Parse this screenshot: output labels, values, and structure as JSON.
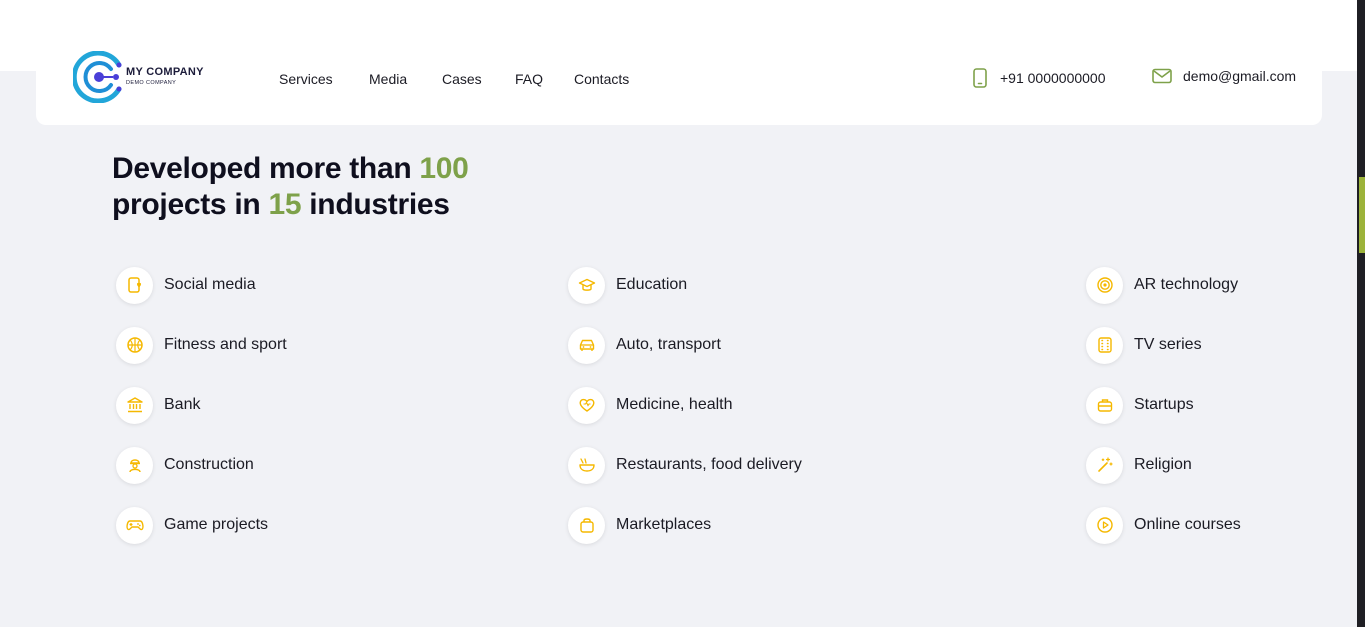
{
  "logo": {
    "name": "MY COMPANY",
    "subtitle": "DEMO COMPANY"
  },
  "nav": [
    "Services",
    "Media",
    "Cases",
    "FAQ",
    "Contacts"
  ],
  "contacts": {
    "phone": "+91 0000000000",
    "email": "demo@gmail.com"
  },
  "headline": {
    "part1": "Developed more than ",
    "num1": "100",
    "part2": "projects in ",
    "num2": "15",
    "part3": " industries"
  },
  "industries": {
    "col1": [
      {
        "label": "Social media",
        "icon": "social-media-icon"
      },
      {
        "label": "Fitness and sport",
        "icon": "basketball-icon"
      },
      {
        "label": "Bank",
        "icon": "bank-icon"
      },
      {
        "label": "Construction",
        "icon": "builder-icon"
      },
      {
        "label": "Game projects",
        "icon": "gamepad-icon"
      }
    ],
    "col2": [
      {
        "label": "Education",
        "icon": "graduation-cap-icon"
      },
      {
        "label": "Auto, transport",
        "icon": "car-icon"
      },
      {
        "label": "Medicine, health",
        "icon": "heart-icon"
      },
      {
        "label": "Restaurants, food delivery",
        "icon": "food-bowl-icon"
      },
      {
        "label": "Marketplaces",
        "icon": "shopping-bag-icon"
      }
    ],
    "col3": [
      {
        "label": "AR technology",
        "icon": "target-icon"
      },
      {
        "label": "TV series",
        "icon": "film-icon"
      },
      {
        "label": "Startups",
        "icon": "briefcase-icon"
      },
      {
        "label": "Religion",
        "icon": "magic-wand-icon"
      },
      {
        "label": "Online courses",
        "icon": "play-circle-icon"
      }
    ]
  },
  "colors": {
    "accent": "#7ea14a",
    "icon": "#f5b800",
    "background": "#f1f2f6"
  }
}
